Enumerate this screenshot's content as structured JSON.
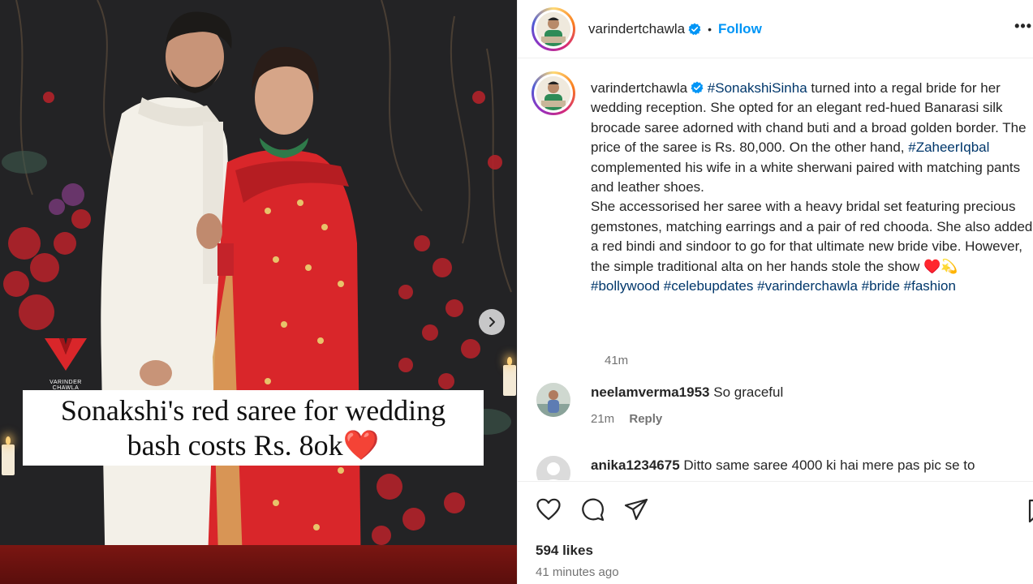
{
  "media": {
    "brand_name": "VARINDER CHAWLA",
    "overlay_line1": "Sonakshi's red saree for wedding",
    "overlay_line2": "bash costs Rs. 8ok",
    "overlay_heart": "❤️",
    "next_icon": "chevron-right-icon"
  },
  "header": {
    "username": "varindertchawla",
    "separator": "•",
    "follow_label": "Follow",
    "more_label": "•••"
  },
  "caption": {
    "username": "varindertchawla",
    "tag1": "#SonakshiSinha",
    "text1": " turned into a regal bride for her wedding reception. She opted for an elegant red-hued Banarasi silk brocade saree adorned with chand buti and a broad golden border. The price of the saree is Rs. 80,000. On the other hand, ",
    "tag2": "#ZaheerIqbal",
    "text2": " complemented his wife in a white sherwani paired with matching pants and leather shoes.",
    "paragraph2": "She accessorised her saree with a heavy bridal set featuring precious gemstones, matching earrings and a pair of red chooda. She also added a red bindi and sindoor to go for that ultimate new bride vibe. However, the simple traditional alta on her hands stole the show ♥️💫",
    "hashtags": [
      "#bollywood",
      "#celebupdates",
      "#varinderchawla",
      "#bride",
      "#fashion"
    ],
    "time": "41m"
  },
  "comments": [
    {
      "username": "neelamverma1953",
      "text": "So graceful",
      "time": "21m",
      "reply_label": "Reply"
    },
    {
      "username": "anika1234675",
      "text": "Ditto same saree 4000 ki hai mere pas pic se to"
    }
  ],
  "actions": {
    "like_icon": "heart-icon",
    "comment_icon": "comment-icon",
    "share_icon": "share-icon",
    "save_icon": "bookmark-icon",
    "likes": "594 likes",
    "posted_ago": "41 minutes ago"
  },
  "colors": {
    "follow": "#0095f6",
    "hashtag": "#00376b",
    "muted": "#737373",
    "saree_red": "#d9262a"
  }
}
